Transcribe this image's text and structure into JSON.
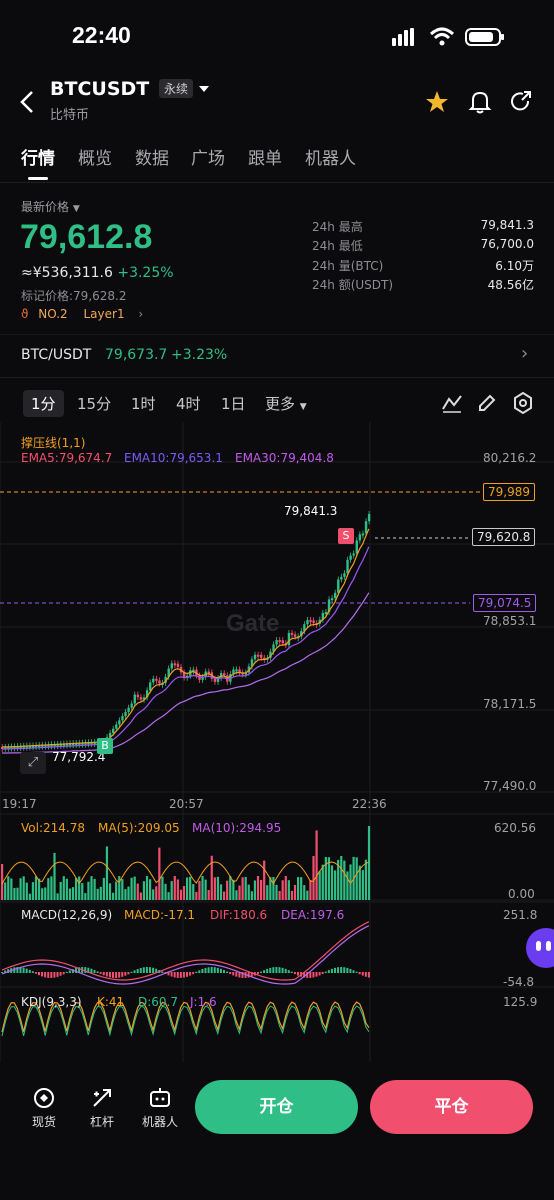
{
  "status_bar": {
    "time": "22:40"
  },
  "header": {
    "symbol": "BTCUSDT",
    "contract_badge": "永续",
    "subtitle": "比特币"
  },
  "tabs": [
    "行情",
    "概览",
    "数据",
    "广场",
    "跟单",
    "机器人"
  ],
  "price": {
    "latest_label": "最新价格",
    "last_price": "79,612.8",
    "cny_value": "≈¥536,311.6",
    "change_pct": "+3.25%",
    "mark_price_label": "标记价格:",
    "mark_price": "79,628.2",
    "rank": "NO.2",
    "layer_tag": "Layer1"
  },
  "stats_24h": [
    {
      "label": "24h  最高",
      "value": "79,841.3"
    },
    {
      "label": "24h  最低",
      "value": "76,700.0"
    },
    {
      "label": "24h  量(BTC)",
      "value": "6.10万"
    },
    {
      "label": "24h  额(USDT)",
      "value": "48.56亿"
    }
  ],
  "spot": {
    "pair": "BTC/USDT",
    "price": "79,673.7",
    "change": "+3.23%"
  },
  "timeframes": [
    "1分",
    "15分",
    "1时",
    "4时",
    "1日",
    "更多"
  ],
  "main_chart": {
    "indicator_title": "撑压线(1,1)",
    "ema5": "EMA5:79,674.7",
    "ema10": "EMA10:79,653.1",
    "ema30": "EMA30:79,404.8",
    "y_ticks": [
      "80,216.2",
      "78,853.1",
      "78,171.5",
      "77,490.0"
    ],
    "resistance": "79,989",
    "current": "79,620.8",
    "support": "79,074.5",
    "high_label": "79,841.3",
    "low_label": "77,792.4",
    "buy_marker": "B",
    "sell_marker": "S",
    "x_ticks": [
      "19:17",
      "20:57",
      "22:36"
    ],
    "watermark": "Gate",
    "colors": {
      "up": "#2fbf86",
      "down": "#f0506e",
      "ema5": "#f0a020",
      "ema10": "#9b59f5",
      "ema30": "#b56cf0"
    }
  },
  "volume": {
    "vol": "Vol:214.78",
    "ma5": "MA(5):209.05",
    "ma10": "MA(10):294.95",
    "y_top": "620.56",
    "y_bottom": "0.00"
  },
  "macd": {
    "title": "MACD(12,26,9)",
    "macd": "MACD:-17.1",
    "dif": "DIF:180.6",
    "dea": "DEA:197.6",
    "y_top": "251.8",
    "y_bottom": "-54.8"
  },
  "kdj": {
    "title": "KDJ(9,3,3)",
    "k": "K:41",
    "d": "D:60.7",
    "j": "J:1.6",
    "y_top": "125.9"
  },
  "bottom_nav": [
    {
      "label": "现货",
      "icon": "spot-icon"
    },
    {
      "label": "杠杆",
      "icon": "leverage-icon"
    },
    {
      "label": "机器人",
      "icon": "robot-icon"
    }
  ],
  "actions": {
    "open": "开仓",
    "close": "平仓"
  }
}
